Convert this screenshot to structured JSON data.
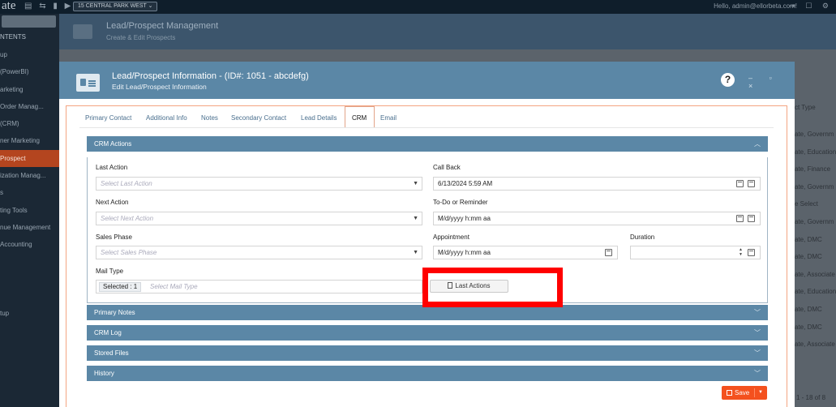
{
  "topbar": {
    "logo": "ate",
    "icons": "▤ ⇆ ▮ ▶",
    "location": "15 CENTRAL PARK WEST ⌄",
    "greeting": "Hello, admin@ellorbeta.com!",
    "right_icons": "⇥ ☐ ⚙"
  },
  "sidebar": {
    "title": "NTENTS",
    "items": [
      {
        "label": "up"
      },
      {
        "label": "(PowerBI)"
      },
      {
        "label": "arketing"
      },
      {
        "label": "Order Manag..."
      },
      {
        "label": "(CRM)"
      },
      {
        "label": "ner Marketing"
      },
      {
        "label": "Prospect"
      },
      {
        "label": "ization Manag..."
      },
      {
        "label": "s"
      },
      {
        "label": "ting Tools"
      },
      {
        "label": "nue Management"
      },
      {
        "label": "Accounting"
      },
      {
        "label": ""
      },
      {
        "label": ""
      },
      {
        "label": ""
      },
      {
        "label": "tup"
      }
    ]
  },
  "background_page": {
    "title": "Lead/Prospect Management",
    "subtitle": "Create & Edit Prospects",
    "column_header": "ct Type",
    "column_values": [
      "ate, Governm",
      "ate, Education",
      "ate, Finance",
      "ate, Governm",
      "e Select",
      "ate, Governm",
      "ate, DMC",
      "ate, DMC",
      "ate, Associate",
      "ate, Education",
      "ate, DMC",
      "ate, DMC",
      "ate, Associate"
    ],
    "pager": "1 - 18 of 8"
  },
  "modal": {
    "title": "Lead/Prospect Information - (ID#: 1051 - abcdefg)",
    "subtitle": "Edit Lead/Prospect Information",
    "help": "?",
    "window_controls": "– ▫ ×",
    "tabs": [
      "Primary Contact",
      "Additional Info",
      "Notes",
      "Secondary Contact",
      "Lead Details",
      "CRM",
      "Email"
    ],
    "crm_actions": {
      "header": "CRM Actions",
      "last_action_label": "Last Action",
      "last_action_placeholder": "Select Last Action",
      "next_action_label": "Next Action",
      "next_action_placeholder": "Select Next Action",
      "sales_phase_label": "Sales Phase",
      "sales_phase_placeholder": "Select Sales Phase",
      "mail_type_label": "Mail Type",
      "mail_type_selected": "Selected : 1",
      "mail_type_placeholder": "Select Mail Type",
      "call_back_label": "Call Back",
      "call_back_value": "6/13/2024 5:59 AM",
      "todo_label": "To-Do or Reminder",
      "todo_value": "M/d/yyyy h:mm aa",
      "appointment_label": "Appointment",
      "appointment_value": "M/d/yyyy h:mm aa",
      "duration_label": "Duration",
      "duration_value": "",
      "last_actions_button": "Last Actions"
    },
    "sections": [
      "Primary Notes",
      "CRM Log",
      "Stored Files",
      "History"
    ],
    "save_label": "Save"
  }
}
